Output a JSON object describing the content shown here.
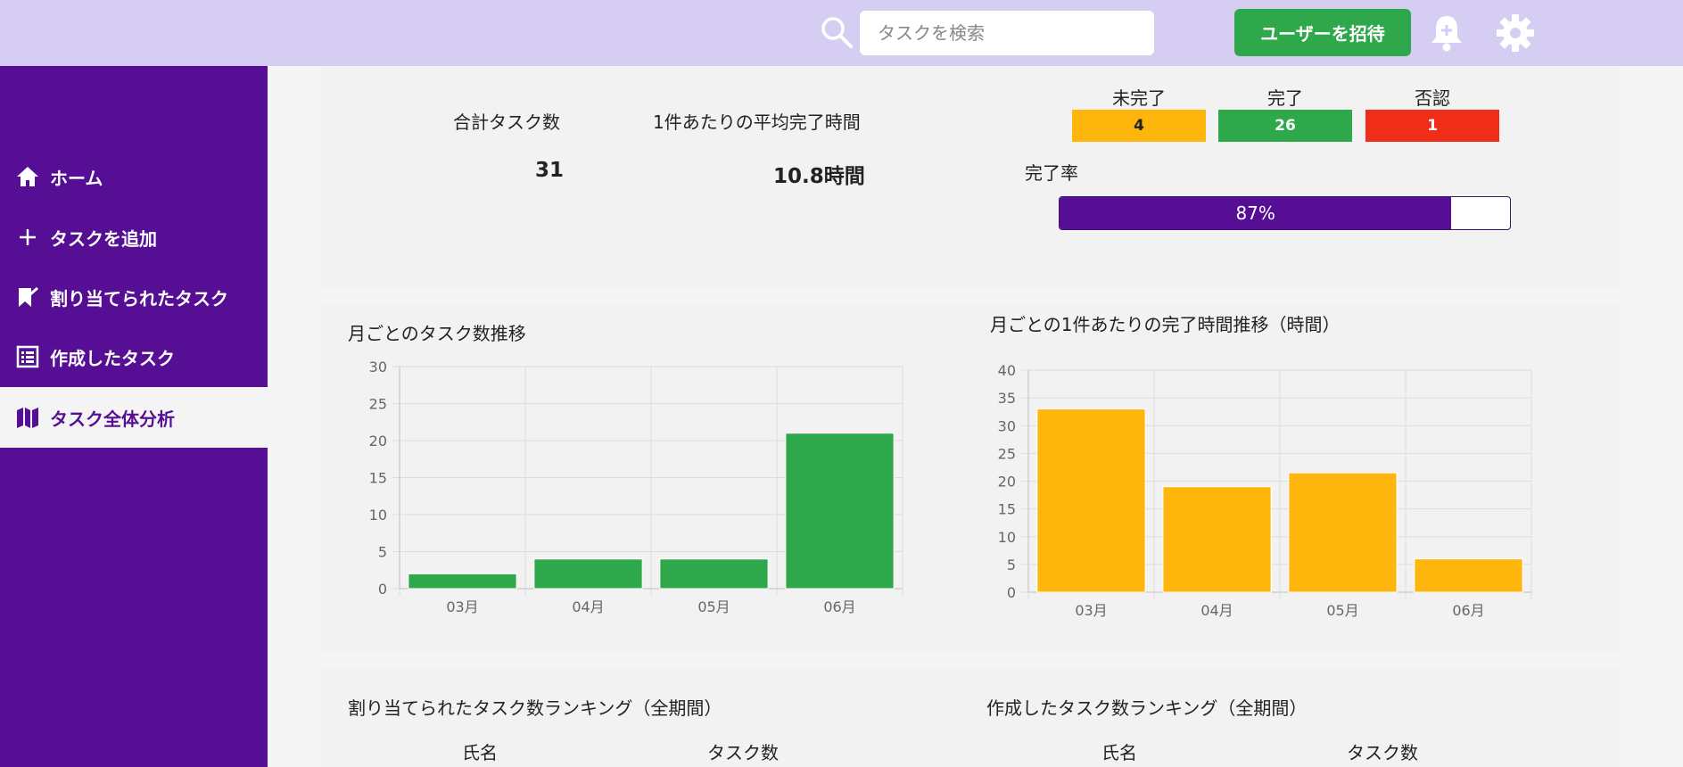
{
  "header": {
    "search_placeholder": "タスクを検索",
    "invite_label": "ユーザーを招待",
    "icons": [
      "search-icon",
      "bell-icon",
      "gear-icon"
    ]
  },
  "sidebar": {
    "items": [
      {
        "label": "ホーム",
        "icon": "home-icon",
        "active": false
      },
      {
        "label": "タスクを追加",
        "icon": "plus-icon",
        "active": false
      },
      {
        "label": "割り当てられたタスク",
        "icon": "bookmark-icon",
        "active": false
      },
      {
        "label": "作成したタスク",
        "icon": "list-icon",
        "active": false
      },
      {
        "label": "タスク全体分析",
        "icon": "map-icon",
        "active": true
      }
    ]
  },
  "stats": {
    "total_label": "合計タスク数",
    "total_value": "31",
    "avg_label": "1件あたりの平均完了時間",
    "avg_value": "10.8時間",
    "status": [
      {
        "label": "未完了",
        "value": "4",
        "color": "#ffb60c"
      },
      {
        "label": "完了",
        "value": "26",
        "color": "#2ea84a"
      },
      {
        "label": "否認",
        "value": "1",
        "color": "#ef2d18"
      }
    ],
    "completion_label": "完了率",
    "completion_rate": 87,
    "completion_text": "87%"
  },
  "charts": {
    "left_title": "月ごとのタスク数推移",
    "right_title": "月ごとの1件あたりの完了時間推移（時間）"
  },
  "chart_data": [
    {
      "type": "bar",
      "title": "月ごとのタスク数推移",
      "categories": [
        "03月",
        "04月",
        "05月",
        "06月"
      ],
      "values": [
        2,
        4,
        4,
        21
      ],
      "ylim": [
        0,
        30
      ],
      "yticks": [
        0,
        5,
        10,
        15,
        20,
        25,
        30
      ],
      "color": "#2ea84a",
      "grid": true
    },
    {
      "type": "bar",
      "title": "月ごとの1件あたりの完了時間推移（時間）",
      "categories": [
        "03月",
        "04月",
        "05月",
        "06月"
      ],
      "values": [
        33,
        19,
        21.5,
        6
      ],
      "ylim": [
        0,
        40
      ],
      "yticks": [
        0,
        5,
        10,
        15,
        20,
        25,
        30,
        35,
        40
      ],
      "color": "#ffb60c",
      "grid": true
    }
  ],
  "ranking": {
    "assigned_title": "割り当てられたタスク数ランキング（全期間）",
    "created_title": "作成したタスク数ランキング（全期間）",
    "col_name": "氏名",
    "col_count": "タスク数"
  },
  "colors": {
    "header_bg": "#d6cdf3",
    "sidebar_bg": "#560f94",
    "accent_green": "#2ea84a",
    "accent_yellow": "#ffb60c",
    "accent_red": "#ef2d18"
  }
}
